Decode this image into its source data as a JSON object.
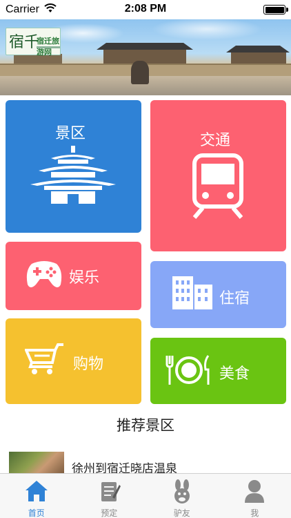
{
  "status_bar": {
    "carrier": "Carrier",
    "time": "2:08 PM"
  },
  "banner": {
    "logo_text": "宿迁旅游网",
    "logo_script": "宿千",
    "page_count": 3,
    "active_page": 1
  },
  "tiles": {
    "scenic": "景区",
    "transport": "交通",
    "entertainment": "娱乐",
    "lodging": "住宿",
    "shopping": "购物",
    "food": "美食"
  },
  "recommended": {
    "title": "推荐景区",
    "items": [
      {
        "title": "徐州到宿迁晓店温泉"
      }
    ]
  },
  "tab_bar": {
    "items": [
      {
        "label": "首页",
        "icon": "home-icon",
        "active": true
      },
      {
        "label": "预定",
        "icon": "booking-icon",
        "active": false
      },
      {
        "label": "驴友",
        "icon": "donkey-friend-icon",
        "active": false
      },
      {
        "label": "我",
        "icon": "person-icon",
        "active": false
      }
    ]
  },
  "colors": {
    "scenic": "#2f82d6",
    "transport": "#fd6171",
    "entertainment": "#fd6171",
    "lodging": "#87a7f7",
    "shopping": "#f5c12f",
    "food": "#6ac412",
    "tab_active": "#2f82d6"
  }
}
